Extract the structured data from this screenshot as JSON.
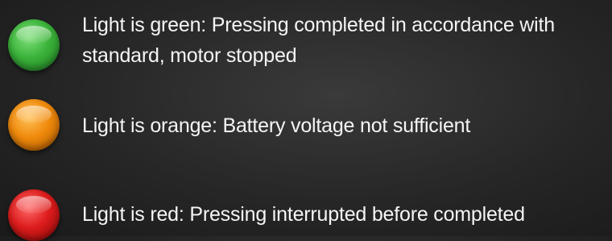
{
  "legend": {
    "items": [
      {
        "color_name": "green",
        "color": "#3bb33a",
        "icon": "green-light-icon",
        "text": "Light is green: Pressing completed in accordance with standard, motor stopped"
      },
      {
        "color_name": "orange",
        "color": "#f08a0c",
        "icon": "orange-light-icon",
        "text": "Light is orange: Battery voltage not sufficient"
      },
      {
        "color_name": "red",
        "color": "#dd1c1c",
        "icon": "red-light-icon",
        "text": "Light is red: Pressing interrupted before completed"
      }
    ]
  }
}
